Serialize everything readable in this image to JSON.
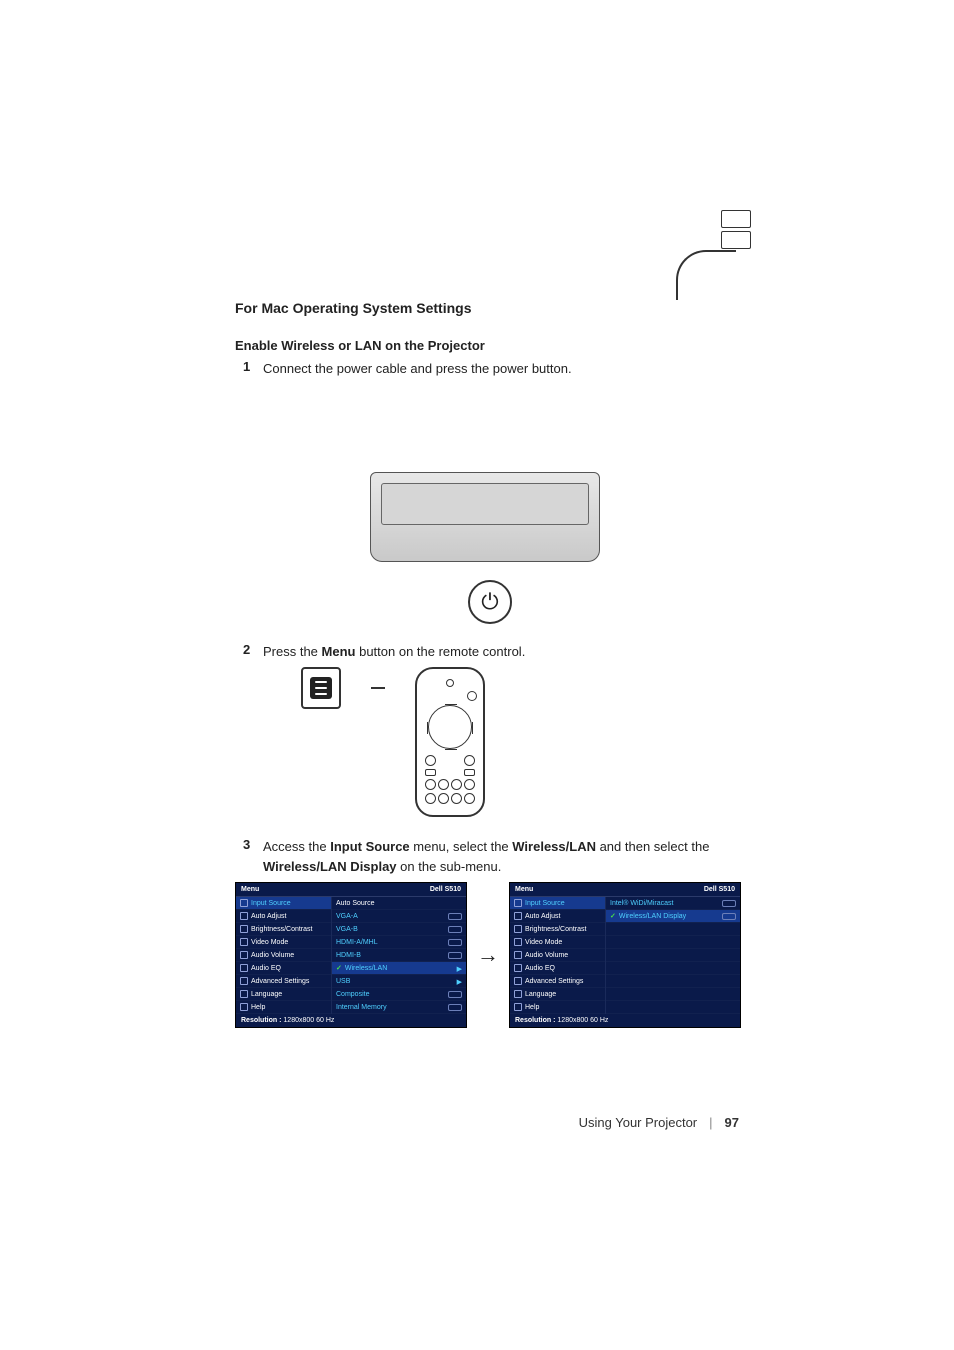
{
  "page": {
    "section_title": "For Mac Operating System Settings",
    "subsection_title": "Enable Wireless or LAN on the Projector",
    "steps": [
      {
        "num": "1",
        "text_parts": [
          "Connect the power cable and press the power button."
        ]
      },
      {
        "num": "2",
        "text_parts": [
          "Press the ",
          "Menu",
          " button on the remote control."
        ]
      },
      {
        "num": "3",
        "text_parts": [
          "Access the ",
          "Input Source",
          " menu, select the ",
          "Wireless/LAN",
          " and then select the ",
          "Wireless/LAN Display",
          " on the sub-menu."
        ]
      }
    ],
    "icons": {
      "power": "⏻",
      "arrow": "→"
    }
  },
  "osd_left": {
    "menu_label": "Menu",
    "model": "Dell S510",
    "left_items": [
      "Input Source",
      "Auto Adjust",
      "Brightness/Contrast",
      "Video Mode",
      "Audio Volume",
      "Audio EQ",
      "Advanced Settings",
      "Language",
      "Help"
    ],
    "right_col": {
      "header": "Auto Source",
      "items": [
        "VGA-A",
        "VGA-B",
        "HDMI-A/MHL",
        "HDMI-B",
        "Wireless/LAN",
        "USB",
        "Composite",
        "Internal Memory"
      ],
      "selected_index": 4
    },
    "footer_label": "Resolution :",
    "footer_value": "1280x800 60 Hz"
  },
  "osd_right": {
    "menu_label": "Menu",
    "model": "Dell S510",
    "left_items": [
      "Input Source",
      "Auto Adjust",
      "Brightness/Contrast",
      "Video Mode",
      "Audio Volume",
      "Audio EQ",
      "Advanced Settings",
      "Language",
      "Help"
    ],
    "right_col": {
      "items": [
        "Intel® WiDi/Miracast",
        "Wireless/LAN Display"
      ],
      "selected_index": 1
    },
    "footer_label": "Resolution :",
    "footer_value": "1280x800 60 Hz"
  },
  "footer": {
    "chapter": "Using Your Projector",
    "page_num": "97"
  }
}
